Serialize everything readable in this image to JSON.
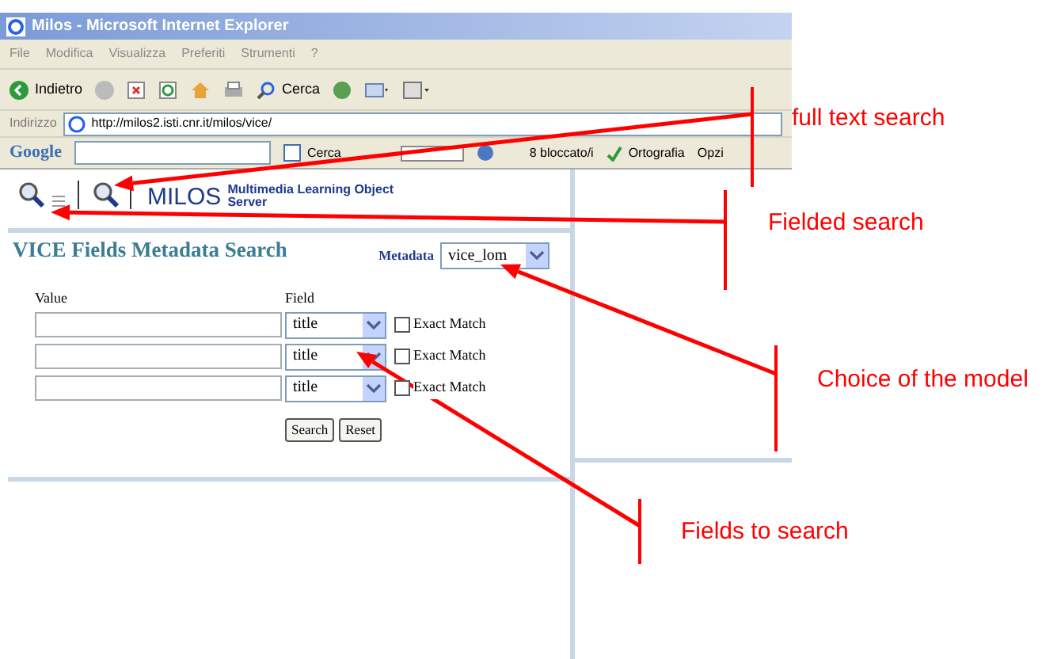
{
  "window": {
    "title": "Milos - Microsoft Internet Explorer"
  },
  "menu": [
    "File",
    "Modifica",
    "Visualizza",
    "Preferiti",
    "Strumenti",
    "?"
  ],
  "toolbar": {
    "back": "Indietro",
    "search": "Cerca"
  },
  "address": {
    "label": "Indirizzo",
    "url": "http://milos2.isti.cnr.it/milos/vice/"
  },
  "google_bar": {
    "logo": "Google",
    "search": "Cerca",
    "blocked": "8 bloccato/i",
    "spelling": "Ortografia",
    "options": "Opzi"
  },
  "header": {
    "logo": "MILOS",
    "subtitle": "Multimedia Learning Object Server"
  },
  "form": {
    "title": "VICE Fields Metadata Search",
    "metadata_label": "Metadata",
    "metadata_value": "vice_lom",
    "value_header": "Value",
    "field_header": "Field",
    "rows": [
      {
        "field": "title",
        "exact_label": "Exact Match",
        "checked": false
      },
      {
        "field": "title",
        "exact_label": "Exact Match",
        "checked": false
      },
      {
        "field": "title",
        "exact_label": "Exact Match",
        "checked": false
      }
    ],
    "buttons": [
      "Search",
      "Reset"
    ]
  },
  "annotations": [
    "full text search",
    "Fielded search",
    "Choice of the model",
    "Fields to search"
  ]
}
